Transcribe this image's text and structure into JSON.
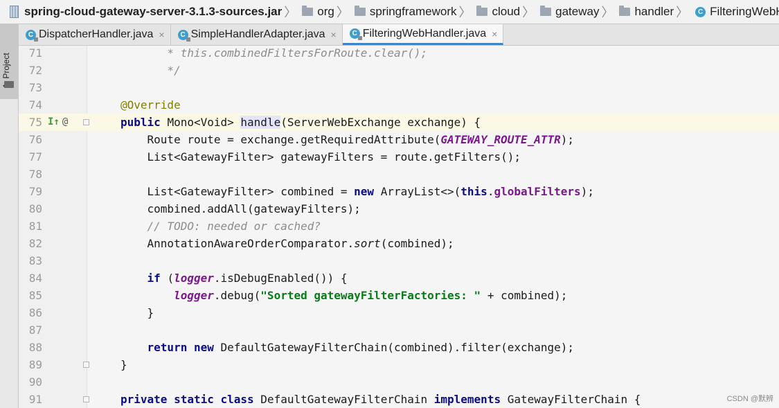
{
  "breadcrumb": {
    "jar": "spring-cloud-gateway-server-3.1.3-sources.jar",
    "folders": [
      "org",
      "springframework",
      "cloud",
      "gateway",
      "handler"
    ],
    "class": "FilteringWebHandler",
    "class_icon": "C"
  },
  "tool_strip": {
    "project_label": "1: Project"
  },
  "tabs": [
    {
      "label": "DispatcherHandler.java",
      "icon": "C",
      "close": "×",
      "active": false
    },
    {
      "label": "SimpleHandlerAdapter.java",
      "icon": "C",
      "close": "×",
      "active": false
    },
    {
      "label": "FilteringWebHandler.java",
      "icon": "C",
      "close": "×",
      "active": true
    }
  ],
  "gutter_marks": {
    "implements": "I↑",
    "annotation": "@"
  },
  "lines": [
    {
      "n": "71",
      "segs": [
        [
          "       * this.combinedFiltersForRoute.clear();",
          "cm"
        ]
      ]
    },
    {
      "n": "72",
      "segs": [
        [
          "       */",
          "cm"
        ]
      ]
    },
    {
      "n": "73",
      "segs": []
    },
    {
      "n": "74",
      "segs": [
        [
          "@Override",
          "an"
        ]
      ]
    },
    {
      "n": "75",
      "segs": [
        [
          "public ",
          "kw"
        ],
        [
          "Mono<Void> ",
          ""
        ],
        [
          "handle",
          "hlw"
        ],
        [
          "(ServerWebExchange exchange) {",
          ""
        ]
      ]
    },
    {
      "n": "76",
      "segs": [
        [
          "    Route route = exchange.getRequiredAttribute(",
          ""
        ],
        [
          "GATEWAY_ROUTE_ATTR",
          "cf"
        ],
        [
          ");",
          ""
        ]
      ]
    },
    {
      "n": "77",
      "segs": [
        [
          "    List<GatewayFilter> gatewayFilters = route.getFilters();",
          ""
        ]
      ]
    },
    {
      "n": "78",
      "segs": []
    },
    {
      "n": "79",
      "segs": [
        [
          "    List<GatewayFilter> combined = ",
          ""
        ],
        [
          "new ",
          "kw"
        ],
        [
          "ArrayList<>(",
          ""
        ],
        [
          "this",
          "kw"
        ],
        [
          ".",
          ""
        ],
        [
          "globalFilters",
          "fd"
        ],
        [
          ");",
          ""
        ]
      ]
    },
    {
      "n": "80",
      "segs": [
        [
          "    combined.addAll(gatewayFilters);",
          ""
        ]
      ]
    },
    {
      "n": "81",
      "segs": [
        [
          "    // TODO: needed or cached?",
          "cm"
        ]
      ]
    },
    {
      "n": "82",
      "segs": [
        [
          "    AnnotationAwareOrderComparator.",
          ""
        ],
        [
          "sort",
          "sf"
        ],
        [
          "(combined);",
          ""
        ]
      ]
    },
    {
      "n": "83",
      "segs": []
    },
    {
      "n": "84",
      "segs": [
        [
          "    ",
          ""
        ],
        [
          "if ",
          "kw"
        ],
        [
          "(",
          ""
        ],
        [
          "logger",
          "cf"
        ],
        [
          ".isDebugEnabled()) {",
          ""
        ]
      ]
    },
    {
      "n": "85",
      "segs": [
        [
          "        ",
          ""
        ],
        [
          "logger",
          "cf"
        ],
        [
          ".debug(",
          ""
        ],
        [
          "\"Sorted gatewayFilterFactories: \"",
          "st"
        ],
        [
          " + combined);",
          ""
        ]
      ]
    },
    {
      "n": "86",
      "segs": [
        [
          "    }",
          ""
        ]
      ]
    },
    {
      "n": "87",
      "segs": []
    },
    {
      "n": "88",
      "segs": [
        [
          "    ",
          ""
        ],
        [
          "return new ",
          "kw"
        ],
        [
          "DefaultGatewayFilterChain(combined).filter(exchange);",
          ""
        ]
      ]
    },
    {
      "n": "89",
      "segs": [
        [
          "}",
          ""
        ]
      ]
    },
    {
      "n": "90",
      "segs": []
    },
    {
      "n": "91",
      "segs": [
        [
          "private static class ",
          "kw"
        ],
        [
          "DefaultGatewayFilterChain ",
          ""
        ],
        [
          "implements ",
          "kw"
        ],
        [
          "GatewayFilterChain {",
          ""
        ]
      ]
    }
  ],
  "watermark": "CSDN @默辨"
}
